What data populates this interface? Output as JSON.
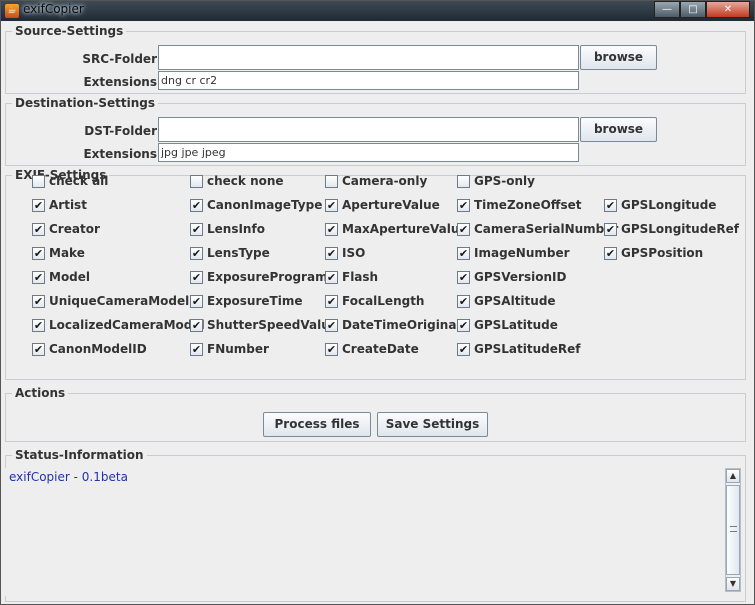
{
  "window": {
    "title": "exifCopier",
    "minimize": "—",
    "maximize": "□",
    "close": "✕"
  },
  "source": {
    "legend": "Source-Settings",
    "folder_label": "SRC-Folder",
    "folder_value": "",
    "ext_label": "Extensions",
    "ext_value": "dng cr cr2",
    "browse": "browse"
  },
  "destination": {
    "legend": "Destination-Settings",
    "folder_label": "DST-Folder",
    "folder_value": "",
    "ext_label": "Extensions",
    "ext_value": "jpg jpe jpeg",
    "browse": "browse"
  },
  "exif": {
    "legend": "EXIF-Settings",
    "checkboxes": [
      {
        "label": "check all",
        "checked": false
      },
      {
        "label": "check none",
        "checked": false
      },
      {
        "label": "Camera-only",
        "checked": false
      },
      {
        "label": "GPS-only",
        "checked": false
      },
      {
        "label": "Artist",
        "checked": true
      },
      {
        "label": "CanonImageType",
        "checked": true
      },
      {
        "label": "ApertureValue",
        "checked": true
      },
      {
        "label": "TimeZoneOffset",
        "checked": true
      },
      {
        "label": "GPSLongitude",
        "checked": true
      },
      {
        "label": "Creator",
        "checked": true
      },
      {
        "label": "LensInfo",
        "checked": true
      },
      {
        "label": "MaxApertureValue",
        "checked": true
      },
      {
        "label": "CameraSerialNumber",
        "checked": true
      },
      {
        "label": "GPSLongitudeRef",
        "checked": true
      },
      {
        "label": "Make",
        "checked": true
      },
      {
        "label": "LensType",
        "checked": true
      },
      {
        "label": "ISO",
        "checked": true
      },
      {
        "label": "ImageNumber",
        "checked": true
      },
      {
        "label": "GPSPosition",
        "checked": true
      },
      {
        "label": "Model",
        "checked": true
      },
      {
        "label": "ExposureProgram",
        "checked": true
      },
      {
        "label": "Flash",
        "checked": true
      },
      {
        "label": "GPSVersionID",
        "checked": true
      },
      {
        "label": "UniqueCameraModel",
        "checked": true
      },
      {
        "label": "ExposureTime",
        "checked": true
      },
      {
        "label": "FocalLength",
        "checked": true
      },
      {
        "label": "GPSAltitude",
        "checked": true
      },
      {
        "label": "LocalizedCameraModel",
        "checked": true
      },
      {
        "label": "ShutterSpeedValue",
        "checked": true
      },
      {
        "label": "DateTimeOriginal",
        "checked": true
      },
      {
        "label": "GPSLatitude",
        "checked": true
      },
      {
        "label": "CanonModelID",
        "checked": true
      },
      {
        "label": "FNumber",
        "checked": true
      },
      {
        "label": "CreateDate",
        "checked": true
      },
      {
        "label": "GPSLatitudeRef",
        "checked": true
      }
    ]
  },
  "actions": {
    "legend": "Actions",
    "process": "Process files",
    "save": "Save Settings"
  },
  "status": {
    "legend": "Status-Information",
    "text": "exifCopier - 0.1beta"
  },
  "scrollbar": {
    "up": "▲",
    "down": "▼"
  },
  "colors": {
    "status_text": "#2233aa",
    "title_bar": "#2a3540"
  }
}
